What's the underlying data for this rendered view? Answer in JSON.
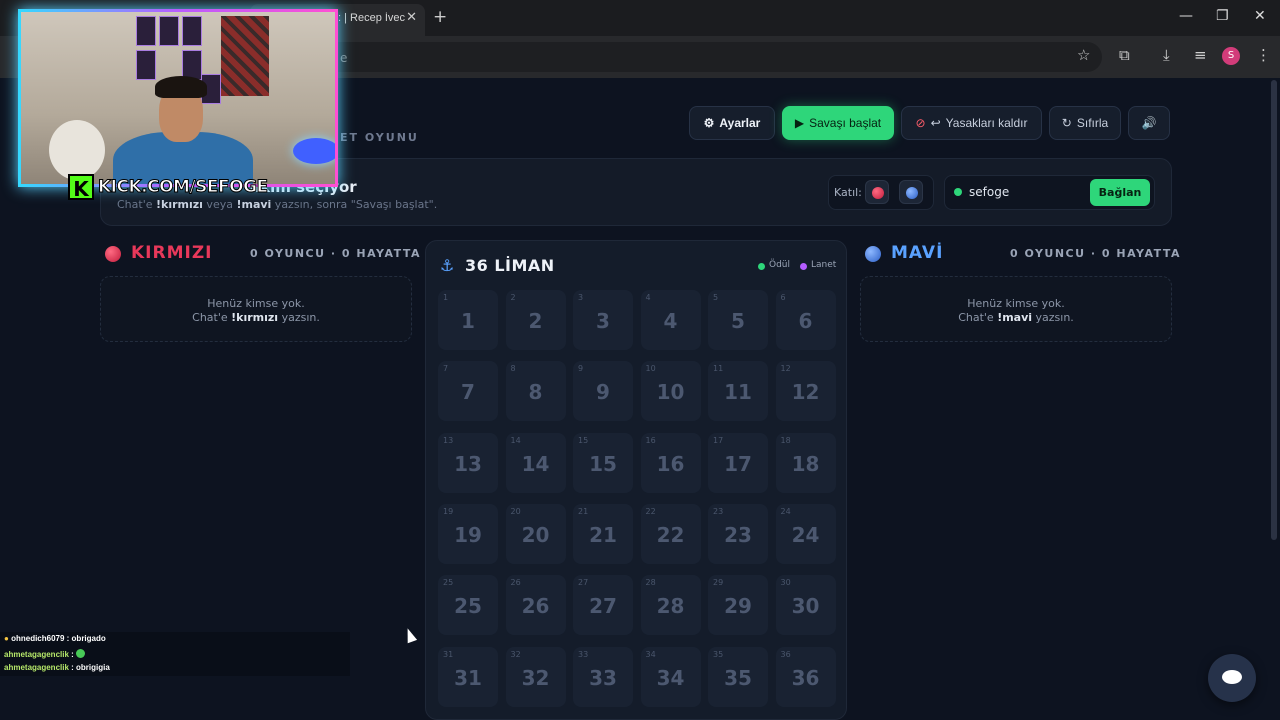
{
  "browser": {
    "tab_title": ": | Recep İvec",
    "address_tail": "e",
    "profile_initial": "S"
  },
  "overlay": {
    "kick_logo": "K",
    "kick_text": "KICK.COM/SEFOGE"
  },
  "header": {
    "subtitle": "ET OYUNU",
    "buttons": {
      "settings": "Ayarlar",
      "start": "Savaşı başlat",
      "unban": "Yasakları kaldır",
      "reset": "Sıfırla",
      "sound_icon": "speaker-icon"
    }
  },
  "status": {
    "title": "akım seçiyor",
    "sub_prefix": "Chat'e ",
    "sub_red": "!kırmızı",
    "sub_mid": " veya ",
    "sub_blue": "!mavi",
    "sub_suffix": " yazsın, sonra \"Savaşı başlat\".",
    "join_label": "Katıl:",
    "channel": "sefoge",
    "connect": "Bağlan"
  },
  "teams": {
    "red": {
      "name": "KIRMIZI",
      "count": "0 OYUNCU · 0 HAYATTA",
      "empty1": "Henüz kimse yok.",
      "empty2_a": "Chat'e ",
      "empty2_b": "!kırmızı",
      "empty2_c": " yazsın.",
      "color": "#e8385a"
    },
    "blue": {
      "name": "MAVİ",
      "count": "0 OYUNCU · 0 HAYATTA",
      "empty1": "Henüz kimse yok.",
      "empty2_a": "Chat'e ",
      "empty2_b": "!mavi",
      "empty2_c": " yazsın.",
      "color": "#5a8ee8"
    }
  },
  "board": {
    "title": "36 LİMAN",
    "legend_reward": "Ödül",
    "legend_curse": "Lanet",
    "colors": {
      "reward": "#2ed67a",
      "curse": "#b45cff"
    },
    "cells": [
      "1",
      "2",
      "3",
      "4",
      "5",
      "6",
      "7",
      "8",
      "9",
      "10",
      "11",
      "12",
      "13",
      "14",
      "15",
      "16",
      "17",
      "18",
      "19",
      "20",
      "21",
      "22",
      "23",
      "24",
      "25",
      "26",
      "27",
      "28",
      "29",
      "30",
      "31",
      "32",
      "33",
      "34",
      "35",
      "36"
    ]
  },
  "chat": [
    {
      "user": "ohnedich6079",
      "text": "obrigado"
    },
    {
      "user": "ahmetagagenclik",
      "text": ""
    },
    {
      "user": "ahmetagagenclik",
      "text": "obrigigia"
    }
  ]
}
